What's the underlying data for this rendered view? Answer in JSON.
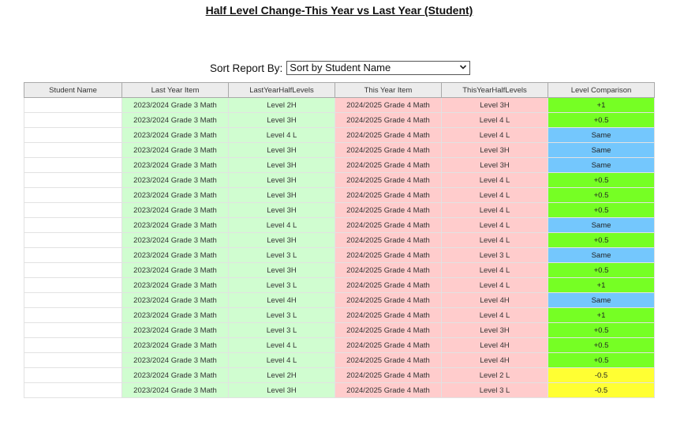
{
  "title": "Half Level Change-This Year vs Last Year (Student)",
  "sort": {
    "label": "Sort Report By:",
    "selected": "Sort by Student Name"
  },
  "colors": {
    "last_year": "#d0fdd0",
    "this_year": "#ffcccc",
    "up": "#76ff24",
    "same": "#74c7fd",
    "down": "#ffff33"
  },
  "table": {
    "headers": [
      "Student Name",
      "Last Year Item",
      "LastYearHalfLevels",
      "This Year Item",
      "ThisYearHalfLevels",
      "Level Comparison"
    ],
    "rows": [
      {
        "name": "",
        "ly": "2023/2024 Grade 3 Math",
        "lyh": "Level 2H",
        "ty": "2024/2025 Grade 4 Math",
        "tyh": "Level 3H",
        "cmp": "+1",
        "status": "up"
      },
      {
        "name": "",
        "ly": "2023/2024 Grade 3 Math",
        "lyh": "Level 3H",
        "ty": "2024/2025 Grade 4 Math",
        "tyh": "Level 4 L",
        "cmp": "+0.5",
        "status": "up"
      },
      {
        "name": "",
        "ly": "2023/2024 Grade 3 Math",
        "lyh": "Level 4 L",
        "ty": "2024/2025 Grade 4 Math",
        "tyh": "Level 4 L",
        "cmp": "Same",
        "status": "same"
      },
      {
        "name": "",
        "ly": "2023/2024 Grade 3 Math",
        "lyh": "Level 3H",
        "ty": "2024/2025 Grade 4 Math",
        "tyh": "Level 3H",
        "cmp": "Same",
        "status": "same"
      },
      {
        "name": "",
        "ly": "2023/2024 Grade 3 Math",
        "lyh": "Level 3H",
        "ty": "2024/2025 Grade 4 Math",
        "tyh": "Level 3H",
        "cmp": "Same",
        "status": "same"
      },
      {
        "name": "",
        "ly": "2023/2024 Grade 3 Math",
        "lyh": "Level 3H",
        "ty": "2024/2025 Grade 4 Math",
        "tyh": "Level 4 L",
        "cmp": "+0.5",
        "status": "up"
      },
      {
        "name": "",
        "ly": "2023/2024 Grade 3 Math",
        "lyh": "Level 3H",
        "ty": "2024/2025 Grade 4 Math",
        "tyh": "Level 4 L",
        "cmp": "+0.5",
        "status": "up"
      },
      {
        "name": "",
        "ly": "2023/2024 Grade 3 Math",
        "lyh": "Level 3H",
        "ty": "2024/2025 Grade 4 Math",
        "tyh": "Level 4 L",
        "cmp": "+0.5",
        "status": "up"
      },
      {
        "name": "",
        "ly": "2023/2024 Grade 3 Math",
        "lyh": "Level 4 L",
        "ty": "2024/2025 Grade 4 Math",
        "tyh": "Level 4 L",
        "cmp": "Same",
        "status": "same"
      },
      {
        "name": "",
        "ly": "2023/2024 Grade 3 Math",
        "lyh": "Level 3H",
        "ty": "2024/2025 Grade 4 Math",
        "tyh": "Level 4 L",
        "cmp": "+0.5",
        "status": "up"
      },
      {
        "name": "",
        "ly": "2023/2024 Grade 3 Math",
        "lyh": "Level 3 L",
        "ty": "2024/2025 Grade 4 Math",
        "tyh": "Level 3 L",
        "cmp": "Same",
        "status": "same"
      },
      {
        "name": "",
        "ly": "2023/2024 Grade 3 Math",
        "lyh": "Level 3H",
        "ty": "2024/2025 Grade 4 Math",
        "tyh": "Level 4 L",
        "cmp": "+0.5",
        "status": "up"
      },
      {
        "name": "",
        "ly": "2023/2024 Grade 3 Math",
        "lyh": "Level 3 L",
        "ty": "2024/2025 Grade 4 Math",
        "tyh": "Level 4 L",
        "cmp": "+1",
        "status": "up"
      },
      {
        "name": "",
        "ly": "2023/2024 Grade 3 Math",
        "lyh": "Level 4H",
        "ty": "2024/2025 Grade 4 Math",
        "tyh": "Level 4H",
        "cmp": "Same",
        "status": "same"
      },
      {
        "name": "",
        "ly": "2023/2024 Grade 3 Math",
        "lyh": "Level 3 L",
        "ty": "2024/2025 Grade 4 Math",
        "tyh": "Level 4 L",
        "cmp": "+1",
        "status": "up"
      },
      {
        "name": "",
        "ly": "2023/2024 Grade 3 Math",
        "lyh": "Level 3 L",
        "ty": "2024/2025 Grade 4 Math",
        "tyh": "Level 3H",
        "cmp": "+0.5",
        "status": "up"
      },
      {
        "name": "",
        "ly": "2023/2024 Grade 3 Math",
        "lyh": "Level 4 L",
        "ty": "2024/2025 Grade 4 Math",
        "tyh": "Level 4H",
        "cmp": "+0.5",
        "status": "up"
      },
      {
        "name": "",
        "ly": "2023/2024 Grade 3 Math",
        "lyh": "Level 4 L",
        "ty": "2024/2025 Grade 4 Math",
        "tyh": "Level 4H",
        "cmp": "+0.5",
        "status": "up"
      },
      {
        "name": "",
        "ly": "2023/2024 Grade 3 Math",
        "lyh": "Level 2H",
        "ty": "2024/2025 Grade 4 Math",
        "tyh": "Level 2 L",
        "cmp": "-0.5",
        "status": "down"
      },
      {
        "name": "",
        "ly": "2023/2024 Grade 3 Math",
        "lyh": "Level 3H",
        "ty": "2024/2025 Grade 4 Math",
        "tyh": "Level 3 L",
        "cmp": "-0.5",
        "status": "down"
      }
    ]
  }
}
